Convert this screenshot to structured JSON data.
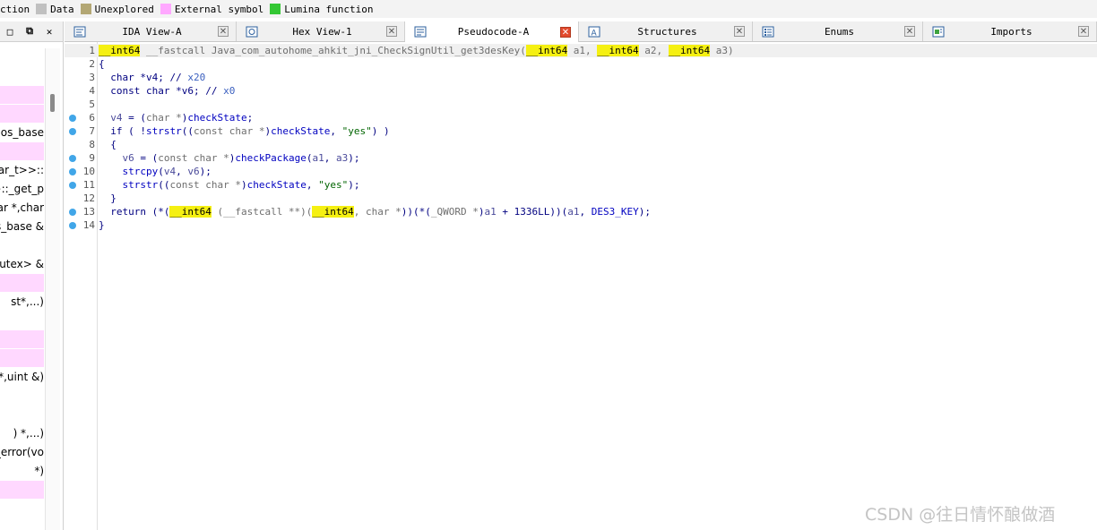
{
  "legend": [
    {
      "label": "ction",
      "color": "#f3f3f3"
    },
    {
      "label": "Data",
      "color": "#c0c0c0"
    },
    {
      "label": "Unexplored",
      "color": "#b3a774"
    },
    {
      "label": "External symbol",
      "color": "#ffa8ff"
    },
    {
      "label": "Lumina function",
      "color": "#34c734"
    }
  ],
  "left_panel": {
    "controls": [
      "□",
      "⧉",
      "✕"
    ],
    "rows": [
      {
        "text": "",
        "pink": false
      },
      {
        "text": "",
        "pink": false
      },
      {
        "text": "",
        "pink": true
      },
      {
        "text": "",
        "pink": true
      },
      {
        "text": "ios_base",
        "pink": false
      },
      {
        "text": "",
        "pink": true
      },
      {
        "text": "har_t>>::",
        "pink": false
      },
      {
        "text": ">::_get_p",
        "pink": false
      },
      {
        "text": "har *,char",
        "pink": false
      },
      {
        "text": "s_base &",
        "pink": false
      },
      {
        "text": "",
        "pink": false
      },
      {
        "text": "mutex> &",
        "pink": false
      },
      {
        "text": "",
        "pink": true
      },
      {
        "text": "st*,...)",
        "pink": false
      },
      {
        "text": "",
        "pink": false
      },
      {
        "text": "",
        "pink": true
      },
      {
        "text": "",
        "pink": true
      },
      {
        "text": " *,uint &)",
        "pink": false
      },
      {
        "text": "",
        "pink": false
      },
      {
        "text": "",
        "pink": false
      },
      {
        "text": ") *,...)",
        "pink": false
      },
      {
        "text": "_error(vo",
        "pink": false
      },
      {
        "text": "*)",
        "pink": false
      },
      {
        "text": "",
        "pink": true
      }
    ]
  },
  "tabs": [
    {
      "label": "IDA View-A",
      "icon": "ida-view-icon",
      "active": false,
      "close": "✕"
    },
    {
      "label": "Hex View-1",
      "icon": "hex-view-icon",
      "active": false,
      "close": "✕"
    },
    {
      "label": "Pseudocode-A",
      "icon": "pseudocode-icon",
      "active": true,
      "close": "✕"
    },
    {
      "label": "Structures",
      "icon": "structures-icon",
      "active": false,
      "close": "✕"
    },
    {
      "label": "Enums",
      "icon": "enums-icon",
      "active": false,
      "close": "✕"
    },
    {
      "label": "Imports",
      "icon": "imports-icon",
      "active": false,
      "close": "✕"
    }
  ],
  "code": {
    "lines": [
      {
        "num": "1",
        "bp": false,
        "first": true,
        "segs": [
          {
            "t": "__int64",
            "c": "hl"
          },
          {
            "t": " __fastcall Java_com_autohome_ahkit_jni_CheckSignUtil_get3desKey(",
            "c": "c-gray"
          },
          {
            "t": "__int64",
            "c": "hl"
          },
          {
            "t": " a1, ",
            "c": "c-gray"
          },
          {
            "t": "__int64",
            "c": "hl"
          },
          {
            "t": " a2, ",
            "c": "c-gray"
          },
          {
            "t": "__int64",
            "c": "hl"
          },
          {
            "t": " a3)",
            "c": "c-gray"
          }
        ]
      },
      {
        "num": "2",
        "bp": false,
        "segs": [
          {
            "t": "{",
            "c": "c-kw"
          }
        ]
      },
      {
        "num": "3",
        "bp": false,
        "segs": [
          {
            "t": "  char *v4; // ",
            "c": "c-kw"
          },
          {
            "t": "x20",
            "c": "c-cmt"
          }
        ]
      },
      {
        "num": "4",
        "bp": false,
        "segs": [
          {
            "t": "  const char *v6; // ",
            "c": "c-kw"
          },
          {
            "t": "x0",
            "c": "c-cmt"
          }
        ]
      },
      {
        "num": "5",
        "bp": false,
        "segs": [
          {
            "t": "",
            "c": ""
          }
        ]
      },
      {
        "num": "6",
        "bp": true,
        "segs": [
          {
            "t": "  v4",
            "c": "c-var"
          },
          {
            "t": " = (",
            "c": "c-kw"
          },
          {
            "t": "char *",
            "c": "c-gray"
          },
          {
            "t": ")",
            "c": "c-kw"
          },
          {
            "t": "checkState",
            "c": "c-fn"
          },
          {
            "t": ";",
            "c": "c-kw"
          }
        ]
      },
      {
        "num": "7",
        "bp": true,
        "segs": [
          {
            "t": "  if ( !",
            "c": "c-kw"
          },
          {
            "t": "strstr",
            "c": "c-fn"
          },
          {
            "t": "((",
            "c": "c-kw"
          },
          {
            "t": "const char *",
            "c": "c-gray"
          },
          {
            "t": ")",
            "c": "c-kw"
          },
          {
            "t": "checkState",
            "c": "c-fn"
          },
          {
            "t": ", ",
            "c": "c-kw"
          },
          {
            "t": "\"yes\"",
            "c": "c-str"
          },
          {
            "t": ") )",
            "c": "c-kw"
          }
        ]
      },
      {
        "num": "8",
        "bp": false,
        "segs": [
          {
            "t": "  {",
            "c": "c-kw"
          }
        ]
      },
      {
        "num": "9",
        "bp": true,
        "segs": [
          {
            "t": "    v6",
            "c": "c-var"
          },
          {
            "t": " = (",
            "c": "c-kw"
          },
          {
            "t": "const char *",
            "c": "c-gray"
          },
          {
            "t": ")",
            "c": "c-kw"
          },
          {
            "t": "checkPackage",
            "c": "c-fn"
          },
          {
            "t": "(",
            "c": "c-kw"
          },
          {
            "t": "a1",
            "c": "c-var"
          },
          {
            "t": ", ",
            "c": "c-kw"
          },
          {
            "t": "a3",
            "c": "c-var"
          },
          {
            "t": ");",
            "c": "c-kw"
          }
        ]
      },
      {
        "num": "10",
        "bp": true,
        "segs": [
          {
            "t": "    strcpy",
            "c": "c-fn"
          },
          {
            "t": "(",
            "c": "c-kw"
          },
          {
            "t": "v4",
            "c": "c-var"
          },
          {
            "t": ", ",
            "c": "c-kw"
          },
          {
            "t": "v6",
            "c": "c-var"
          },
          {
            "t": ");",
            "c": "c-kw"
          }
        ]
      },
      {
        "num": "11",
        "bp": true,
        "segs": [
          {
            "t": "    strstr",
            "c": "c-fn"
          },
          {
            "t": "((",
            "c": "c-kw"
          },
          {
            "t": "const char *",
            "c": "c-gray"
          },
          {
            "t": ")",
            "c": "c-kw"
          },
          {
            "t": "checkState",
            "c": "c-fn"
          },
          {
            "t": ", ",
            "c": "c-kw"
          },
          {
            "t": "\"yes\"",
            "c": "c-str"
          },
          {
            "t": ");",
            "c": "c-kw"
          }
        ]
      },
      {
        "num": "12",
        "bp": false,
        "segs": [
          {
            "t": "  }",
            "c": "c-kw"
          }
        ]
      },
      {
        "num": "13",
        "bp": true,
        "segs": [
          {
            "t": "  return (*(",
            "c": "c-kw"
          },
          {
            "t": "__int64",
            "c": "hl"
          },
          {
            "t": " (__fastcall **)(",
            "c": "c-gray"
          },
          {
            "t": "__int64",
            "c": "hl"
          },
          {
            "t": ", char *",
            "c": "c-gray"
          },
          {
            "t": "))(*(",
            "c": "c-kw"
          },
          {
            "t": "_QWORD *",
            "c": "c-gray"
          },
          {
            "t": ")",
            "c": "c-kw"
          },
          {
            "t": "a1",
            "c": "c-var"
          },
          {
            "t": " + 1336LL))(",
            "c": "c-kw"
          },
          {
            "t": "a1",
            "c": "c-var"
          },
          {
            "t": ", ",
            "c": "c-kw"
          },
          {
            "t": "DES3_KEY",
            "c": "c-fn"
          },
          {
            "t": ");",
            "c": "c-kw"
          }
        ]
      },
      {
        "num": "14",
        "bp": true,
        "segs": [
          {
            "t": "}",
            "c": "c-kw"
          }
        ]
      }
    ]
  },
  "watermark": "CSDN @往日情怀酿做酒"
}
